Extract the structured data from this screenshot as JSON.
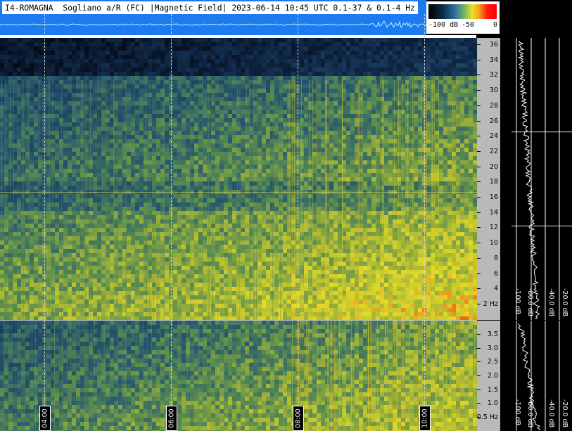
{
  "header": {
    "title": "I4-ROMAGNA  Sogliano a/R (FC) |Magnetic Field| 2023-06-14 10:45 UTC 0.1-37 & 0.1-4 Hz"
  },
  "colorbar": {
    "labels": [
      "-100 dB",
      "-50",
      "0"
    ]
  },
  "colors": {
    "background": "#000000",
    "waveform_band": "#1e7af0",
    "axis_panel": "#b9b9b9"
  },
  "chart_data": [
    {
      "type": "heatmap",
      "title": "",
      "xlabel": "",
      "ylabel": "",
      "y_ticks": [
        "36",
        "34",
        "32",
        "30",
        "28",
        "26",
        "24",
        "22",
        "20",
        "18",
        "16",
        "14",
        "12",
        "10",
        "8",
        "6",
        "4",
        "2 Hz"
      ],
      "y_range": [
        0.1,
        37
      ],
      "x_ticks": [
        "04:00",
        "06:00",
        "08:00",
        "10:00"
      ],
      "grid": true
    },
    {
      "type": "heatmap",
      "title": "",
      "y_ticks": [
        "3.5",
        "3.0",
        "2.5",
        "2.0",
        "1.5",
        "1.0",
        "0.5 Hz"
      ],
      "y_range": [
        0.1,
        4
      ],
      "x_ticks": [
        "04:00",
        "06:00",
        "08:00",
        "10:00"
      ],
      "grid": true
    },
    {
      "type": "line",
      "title": "",
      "x_ticks": [
        "-100 dB",
        "-80.0 dB",
        "-40.0 dB",
        "-20.0 dB"
      ],
      "x_range": [
        -100,
        -20
      ],
      "grid": true
    }
  ]
}
